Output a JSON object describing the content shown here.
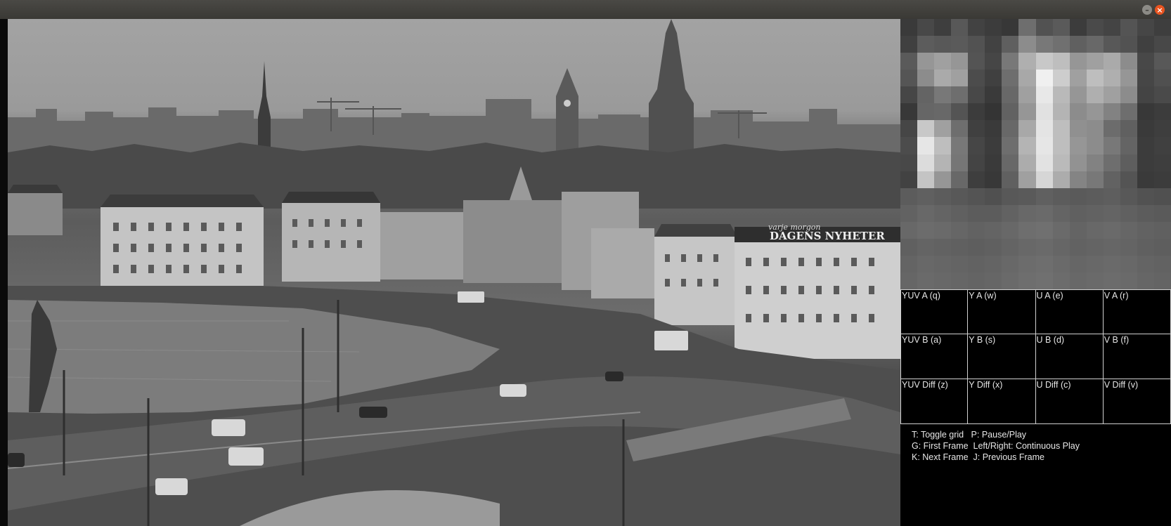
{
  "window": {
    "minimize_glyph": "–",
    "close_glyph": "×"
  },
  "video_frame": {
    "sign_text": "DAGENS NYHETER",
    "sign_script": "varje morgon"
  },
  "zoom_panel": {
    "pixel_levels": [
      [
        58,
        72,
        62,
        88,
        66,
        60,
        55,
        110,
        82,
        90,
        60,
        74,
        68,
        84,
        70,
        62
      ],
      [
        64,
        92,
        88,
        90,
        82,
        66,
        95,
        140,
        120,
        112,
        96,
        104,
        88,
        82,
        64,
        72
      ],
      [
        90,
        150,
        160,
        150,
        84,
        70,
        120,
        175,
        200,
        190,
        150,
        160,
        170,
        140,
        72,
        88
      ],
      [
        85,
        140,
        170,
        160,
        76,
        64,
        110,
        168,
        240,
        205,
        160,
        190,
        175,
        150,
        70,
        80
      ],
      [
        70,
        100,
        120,
        110,
        72,
        58,
        104,
        160,
        232,
        185,
        150,
        175,
        160,
        140,
        68,
        74
      ],
      [
        56,
        102,
        104,
        84,
        60,
        52,
        98,
        150,
        225,
        180,
        140,
        150,
        130,
        110,
        56,
        60
      ],
      [
        70,
        200,
        160,
        110,
        64,
        58,
        104,
        168,
        228,
        190,
        144,
        140,
        108,
        96,
        58,
        62
      ],
      [
        76,
        230,
        190,
        120,
        70,
        60,
        110,
        180,
        230,
        190,
        150,
        140,
        120,
        100,
        60,
        64
      ],
      [
        72,
        220,
        180,
        118,
        68,
        58,
        104,
        172,
        226,
        186,
        146,
        130,
        110,
        94,
        60,
        62
      ],
      [
        66,
        196,
        150,
        104,
        62,
        56,
        96,
        160,
        214,
        172,
        132,
        120,
        98,
        84,
        58,
        60
      ],
      [
        92,
        96,
        92,
        88,
        84,
        80,
        88,
        90,
        96,
        92,
        90,
        92,
        94,
        88,
        82,
        80
      ],
      [
        98,
        104,
        100,
        96,
        92,
        92,
        98,
        104,
        106,
        100,
        96,
        98,
        100,
        96,
        92,
        90
      ],
      [
        104,
        108,
        106,
        102,
        98,
        100,
        104,
        110,
        112,
        106,
        100,
        104,
        106,
        102,
        98,
        96
      ],
      [
        96,
        100,
        98,
        96,
        94,
        96,
        100,
        104,
        106,
        102,
        98,
        100,
        102,
        100,
        96,
        94
      ],
      [
        100,
        104,
        102,
        100,
        98,
        100,
        104,
        108,
        110,
        106,
        102,
        104,
        106,
        104,
        100,
        98
      ],
      [
        102,
        106,
        104,
        102,
        100,
        102,
        106,
        110,
        112,
        108,
        104,
        106,
        108,
        106,
        102,
        100
      ]
    ]
  },
  "grid_cells": [
    [
      "YUV A (q)",
      "Y A (w)",
      "U A (e)",
      "V A (r)"
    ],
    [
      "YUV B (a)",
      "Y B (s)",
      "U B (d)",
      "V B (f)"
    ],
    [
      "YUV Diff (z)",
      "Y Diff (x)",
      "U Diff (c)",
      "V Diff (v)"
    ]
  ],
  "help": {
    "line1": "T: Toggle grid   P: Pause/Play",
    "line2": "G: First Frame  Left/Right: Continuous Play",
    "line3": "K: Next Frame  J: Previous Frame"
  }
}
